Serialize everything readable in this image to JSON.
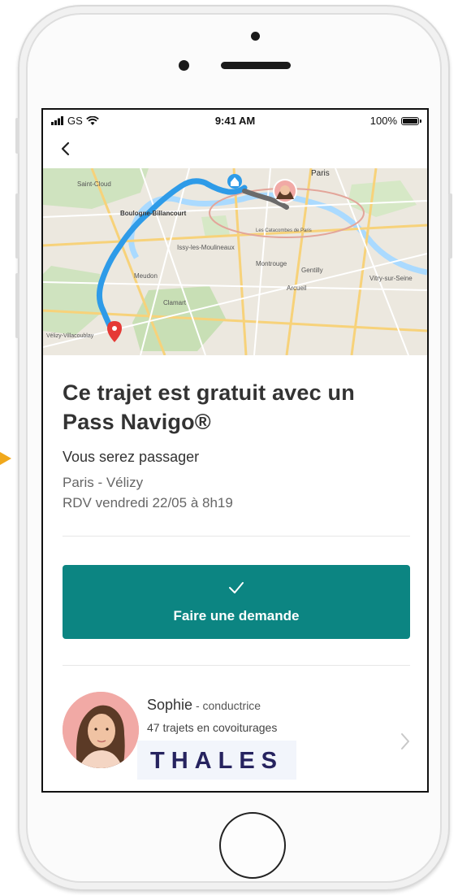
{
  "status_bar": {
    "carrier": "GS",
    "time": "9:41 AM",
    "battery": "100%"
  },
  "icons": {
    "back": "chevron-left-icon",
    "check": "check-icon",
    "forward": "chevron-right-icon"
  },
  "colors": {
    "accent": "#0c8582",
    "route": "#2e9be8",
    "pin": "#e53935",
    "arrow": "#f0a81c"
  },
  "map": {
    "labels": [
      "Paris",
      "Boulogne-Billancourt",
      "Saint-Cloud",
      "Issy-les-Moulineaux",
      "Meudon",
      "Clamart",
      "Montrouge",
      "Gentilly",
      "Arcueil",
      "Vitry-sur-Seine",
      "Vélizy-Villacoublay",
      "Les Catacombes de Paris"
    ]
  },
  "trip": {
    "title": "Ce trajet est gratuit avec un Pass Navigo®",
    "role": "Vous serez passager",
    "route": "Paris - Vélizy",
    "rdv": "RDV vendredi 22/05 à 8h19"
  },
  "cta": {
    "label": "Faire une demande"
  },
  "driver": {
    "name": "Sophie",
    "role": " - conductrice",
    "trips": "47 trajets en covoiturages",
    "company": "THALES"
  }
}
